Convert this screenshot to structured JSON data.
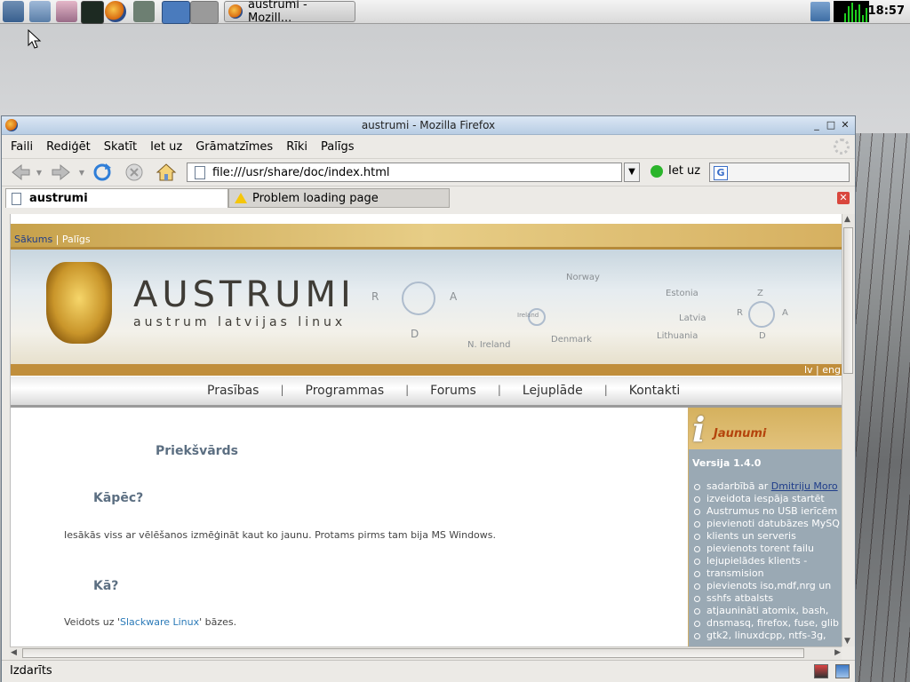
{
  "taskbar": {
    "task_label": "austrumi - Mozill...",
    "clock": "18:57"
  },
  "window": {
    "title": "austrumi - Mozilla Firefox"
  },
  "menu": [
    "Faili",
    "Rediģēt",
    "Skatīt",
    "Iet uz",
    "Grāmatzīmes",
    "Rīki",
    "Palīgs"
  ],
  "navbar": {
    "url": "file:///usr/share/doc/index.html",
    "go_label": "Iet uz",
    "search_engine_letter": "G"
  },
  "tabs": {
    "active": "austrumi",
    "inactive": "Problem loading page"
  },
  "page": {
    "top_links": {
      "home": "Sākums",
      "sep": " | ",
      "help": "Palīgs"
    },
    "banner_title": "AUSTRUMI",
    "banner_subtitle": "austrum latvijas linux",
    "map_labels": [
      "Norway",
      "Estonia",
      "Latvia",
      "Lithuania",
      "Denmark",
      "N. Ireland",
      "Ireland"
    ],
    "compass_letters": [
      "R",
      "A",
      "D",
      "Z"
    ],
    "lang": {
      "lv": "lv",
      "sep": " | ",
      "eng": "eng"
    },
    "nav": [
      "Prasības",
      "Programmas",
      "Forums",
      "Lejuplāde",
      "Kontakti"
    ],
    "nav_sep": "|",
    "heading": "Priekšvārds",
    "section1_title": "Kāpēc?",
    "section1_text": "Iesākās viss ar vēlēšanos izmēģināt kaut ko jaunu. Protams pirms tam bija MS Windows.",
    "section2_title": "Kā?",
    "section2_prefix": "Veidots uz '",
    "section2_link": "Slackware Linux",
    "section2_suffix": "' bāzes."
  },
  "sidebar": {
    "icon_letter": "i",
    "title": "Jaunumi",
    "version": "Versija 1.4.0",
    "item1_prefix": "sadarbībā ar ",
    "item1_link": "Dmitriju Moro",
    "item1_rest": [
      "izveidota iespāja startēt",
      "Austrumus no USB ierīcēm"
    ],
    "items": [
      [
        "pievienoti datubāzes MySQ",
        "klients un serveris"
      ],
      [
        "pievienots torent failu",
        "lejupielādes klients -",
        "transmision"
      ],
      [
        "pievienots iso,mdf,nrg un",
        "sshfs atbalsts"
      ],
      [
        "atjaunināti atomix, bash,",
        "dnsmasq, firefox, fuse, glib",
        "gtk2, linuxdcpp, ntfs-3g,"
      ]
    ]
  },
  "status": {
    "text": "Izdarīts"
  }
}
